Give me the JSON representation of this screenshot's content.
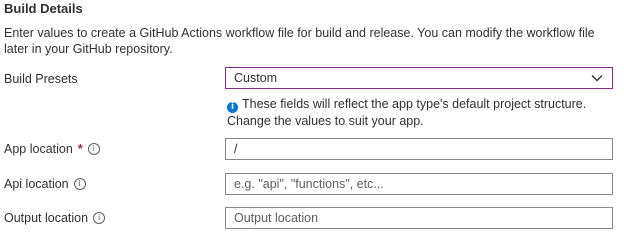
{
  "section": {
    "title": "Build Details",
    "description": "Enter values to create a GitHub Actions workflow file for build and release. You can modify the workflow file later in your GitHub repository."
  },
  "build_presets": {
    "label": "Build Presets",
    "selected": "Custom",
    "note": "These fields will reflect the app type's default project structure. Change the values to suit your app."
  },
  "app_location": {
    "label": "App location",
    "required_marker": "*",
    "value": "/",
    "placeholder": ""
  },
  "api_location": {
    "label": "Api location",
    "value": "",
    "placeholder": "e.g. \"api\", \"functions\", etc..."
  },
  "output_location": {
    "label": "Output location",
    "value": "",
    "placeholder": "Output location"
  },
  "icons": {
    "info": "info-circle-icon",
    "chevron": "chevron-down-icon"
  },
  "colors": {
    "focus_border": "#8a2a8a",
    "required": "#a4262c",
    "info_fill": "#0078d4"
  }
}
